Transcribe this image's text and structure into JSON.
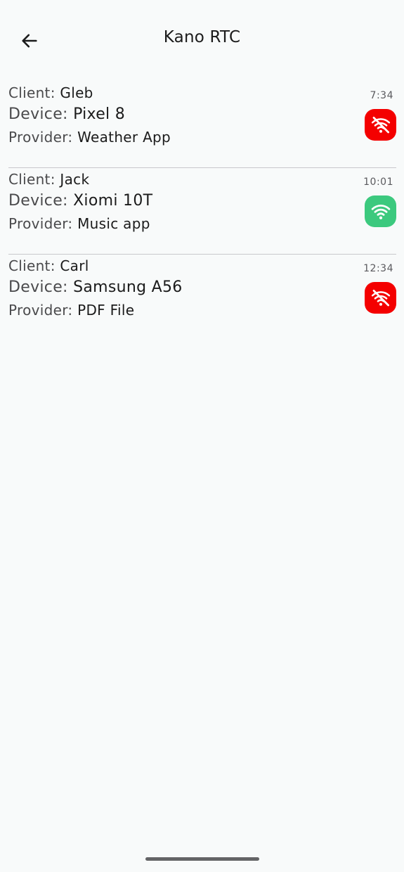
{
  "header": {
    "title": "Kano RTC",
    "back_icon": "arrow-left-icon"
  },
  "labels": {
    "client": "Client:",
    "device": "Device:",
    "provider": "Provider:"
  },
  "colors": {
    "offline": "#f40000",
    "online": "#3cc97e"
  },
  "sessions": [
    {
      "client": "Gleb",
      "device": "Pixel 8",
      "provider": "Weather App",
      "time": "7:34",
      "status": "offline",
      "status_icon": "wifi-off-icon"
    },
    {
      "client": "Jack",
      "device": "Xiomi 10T",
      "provider": "Music app",
      "time": "10:01",
      "status": "online",
      "status_icon": "wifi-icon"
    },
    {
      "client": "Carl",
      "device": "Samsung A56",
      "provider": "PDF File",
      "time": "12:34",
      "status": "offline",
      "status_icon": "wifi-off-icon"
    }
  ]
}
